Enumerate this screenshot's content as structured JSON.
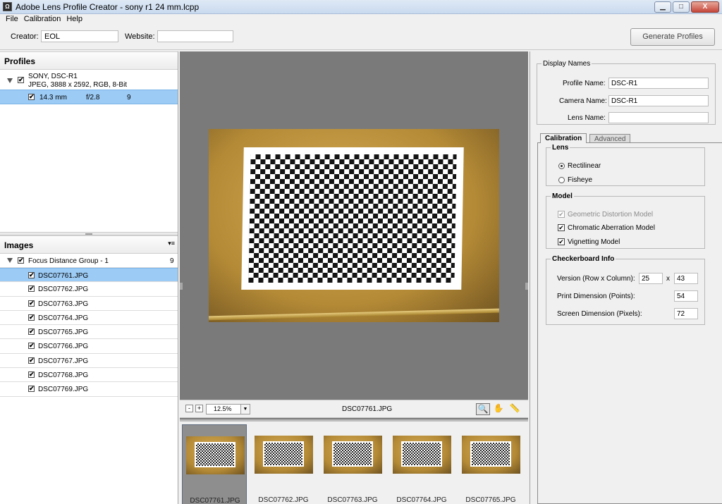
{
  "window": {
    "title": "Adobe Lens Profile Creator - sony r1 24 mm.lcpp",
    "app_icon": "Ω",
    "controls": {
      "minimize": "▁",
      "maximize": "□",
      "close": "X"
    }
  },
  "menu": [
    "File",
    "Calibration",
    "Help"
  ],
  "creator_bar": {
    "creator_label": "Creator:",
    "creator_value": "EOL",
    "website_label": "Website:",
    "website_value": "",
    "generate_button": "Generate Profiles"
  },
  "profiles": {
    "header": "Profiles",
    "camera_line1": "SONY, DSC-R1",
    "camera_line2": "JPEG, 3888 x 2592, RGB, 8-Bit",
    "entry": {
      "focal": "14.3 mm",
      "aperture": "f/2.8",
      "count": "9"
    }
  },
  "images": {
    "header": "Images",
    "menu_icon": "▾≡",
    "group_name": "Focus Distance Group - 1",
    "group_count": "9",
    "files": [
      "DSC07761.JPG",
      "DSC07762.JPG",
      "DSC07763.JPG",
      "DSC07764.JPG",
      "DSC07765.JPG",
      "DSC07766.JPG",
      "DSC07767.JPG",
      "DSC07768.JPG",
      "DSC07769.JPG"
    ]
  },
  "viewer": {
    "zoom_out": "-",
    "zoom_in": "+",
    "zoom_value": "12.5%",
    "dropdown_arrow": "▼",
    "filename": "DSC07761.JPG",
    "tools": {
      "zoom": "🔍",
      "hand": "✋",
      "measure": "📏"
    },
    "thumbnails": [
      "DSC07761.JPG",
      "DSC07762.JPG",
      "DSC07763.JPG",
      "DSC07764.JPG",
      "DSC07765.JPG"
    ]
  },
  "display_names": {
    "legend": "Display Names",
    "profile_name_label": "Profile Name:",
    "profile_name_value": "DSC-R1",
    "camera_name_label": "Camera Name:",
    "camera_name_value": "DSC-R1",
    "lens_name_label": "Lens Name:",
    "lens_name_value": ""
  },
  "tabs": {
    "calibration": "Calibration",
    "advanced": "Advanced"
  },
  "lens": {
    "legend": "Lens",
    "rectilinear": "Rectilinear",
    "fisheye": "Fisheye"
  },
  "model": {
    "legend": "Model",
    "geometric": "Geometric Distortion Model",
    "chromatic": "Chromatic Aberration Model",
    "vignetting": "Vignetting Model"
  },
  "checkerboard": {
    "legend": "Checkerboard Info",
    "version_label": "Version (Row x Column):",
    "rows": "25",
    "times": "x",
    "cols": "43",
    "print_label": "Print Dimension (Points):",
    "print_value": "54",
    "screen_label": "Screen Dimension (Pixels):",
    "screen_value": "72"
  },
  "check_glyph": "✔"
}
